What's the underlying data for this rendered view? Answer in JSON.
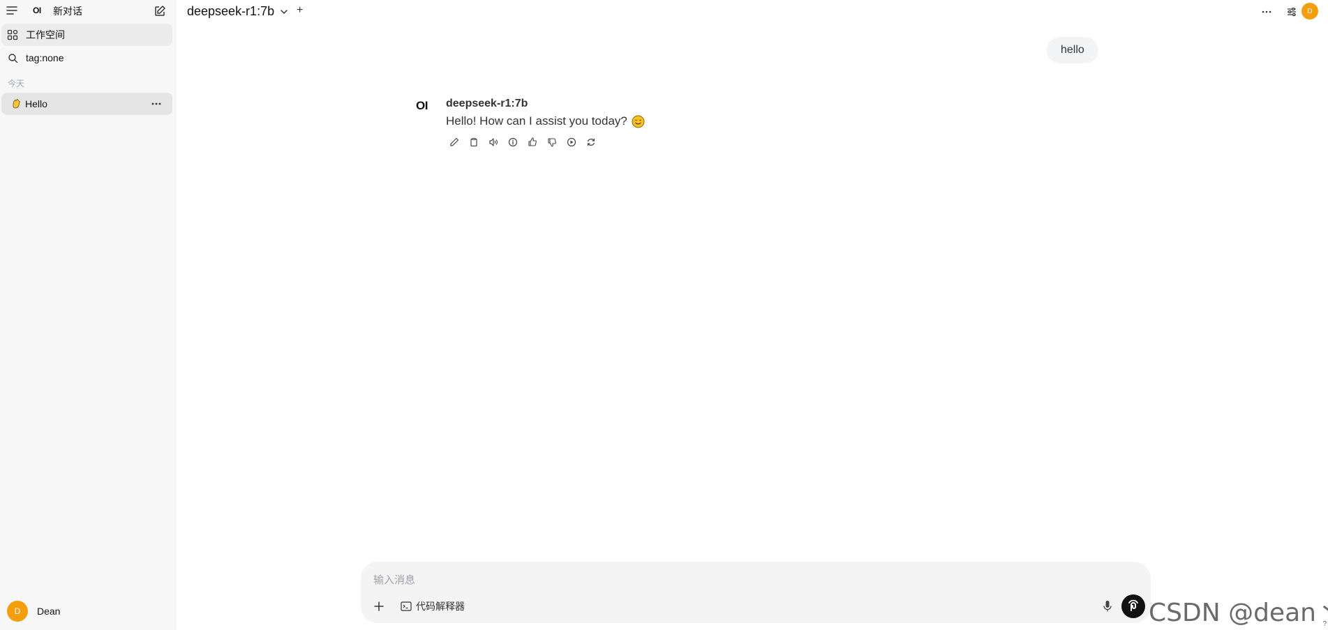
{
  "sidebar": {
    "logo": "OI",
    "new_chat_label": "新对话",
    "workspace_label": "工作空间",
    "search_label": "tag:none",
    "section_today": "今天",
    "chats": [
      {
        "title": "Hello"
      }
    ],
    "user": {
      "avatar_letter": "D",
      "name": "Dean"
    }
  },
  "header": {
    "model_name": "deepseek-r1:7b",
    "add_symbol": "+",
    "avatar_letter": "D"
  },
  "messages": {
    "user_text": "hello",
    "bot_logo": "OI",
    "bot_name": "deepseek-r1:7b",
    "bot_text": "Hello! How can I assist you today?"
  },
  "input": {
    "placeholder": "输入消息",
    "code_interpreter_label": "代码解释器"
  },
  "watermark": "CSDN @dean丶Li",
  "help": "?",
  "colors": {
    "accent": "#f59e0b",
    "sidebar_bg": "#f7f7f7"
  }
}
